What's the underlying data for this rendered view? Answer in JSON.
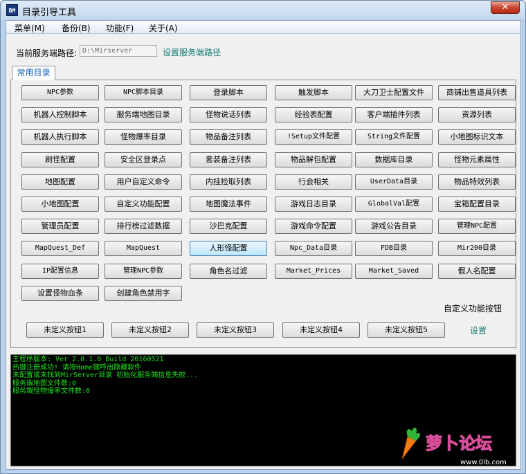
{
  "window": {
    "app_icon_text": "BM",
    "title": "目录引导工具",
    "close_glyph": "✕"
  },
  "menu": [
    "菜单(M)",
    "备份(B)",
    "功能(F)",
    "关于(A)"
  ],
  "path": {
    "label": "当前服务端路径:",
    "value": "D:\\Mirserver",
    "set_link": "设置服务端路径"
  },
  "tab": {
    "label": "常用目录"
  },
  "grid_buttons": [
    [
      "NPC参数",
      "NPC脚本目录",
      "登录脚本",
      "触发脚本",
      "大刀卫士配置文件",
      "商铺出售道具列表"
    ],
    [
      "机器人控制脚本",
      "服务端地图目录",
      "怪物说话列表",
      "经验表配置",
      "客户端插件列表",
      "资源列表"
    ],
    [
      "机器人执行脚本",
      "怪物爆率目录",
      "物品备注列表",
      "!Setup文件配置",
      "String文件配置",
      "小地图标识文本"
    ],
    [
      "刷怪配置",
      "安全区登录点",
      "套装备注列表",
      "物品解包配置",
      "数据库目录",
      "怪物元素属性"
    ],
    [
      "地图配置",
      "用户自定义命令",
      "内挂捡取列表",
      "行会相关",
      "UserData目录",
      "物品特效列表"
    ],
    [
      "小地图配置",
      "自定义功能配置",
      "地图魔法事件",
      "游戏日志目录",
      "GlobalVal配置",
      "宝箱配置目录"
    ],
    [
      "管理员配置",
      "排行榜过滤数据",
      "沙巴克配置",
      "游戏命令配置",
      "游戏公告目录",
      "管理NPC配置"
    ],
    [
      "MapQuest_Def",
      "MapQuest",
      "人形怪配置",
      "Npc_Data目录",
      "FDB目录",
      "Mir200目录"
    ],
    [
      "IP配置信息",
      "管理NPC参数",
      "角色名过滤",
      "Market_Prices",
      "Market_Saved",
      "假人名配置"
    ],
    [
      "设置怪物血条",
      "创建角色禁用字"
    ]
  ],
  "active_button": "人形怪配置",
  "custom": {
    "label": "自定义功能按钮",
    "buttons": [
      "未定义按钮1",
      "未定义按钮2",
      "未定义按钮3",
      "未定义按钮4",
      "未定义按钮5"
    ],
    "settings_link": "设置"
  },
  "console_lines": [
    "主程序版本: Ver 2.0.1.0 Build 20160521",
    "热键注册成功! 请按Home键呼出隐藏软件",
    "未配置或未找到MirServer目录 初始化服务端信息失败...",
    "服务端地图文件数:0",
    "服务端怪物爆率文件数:0"
  ],
  "watermark": {
    "text": "萝卜论坛",
    "url": "www.0lb.com"
  },
  "colors": {
    "link": "#137a72",
    "console_text": "#20e020",
    "tab_text": "#0b5db5"
  }
}
